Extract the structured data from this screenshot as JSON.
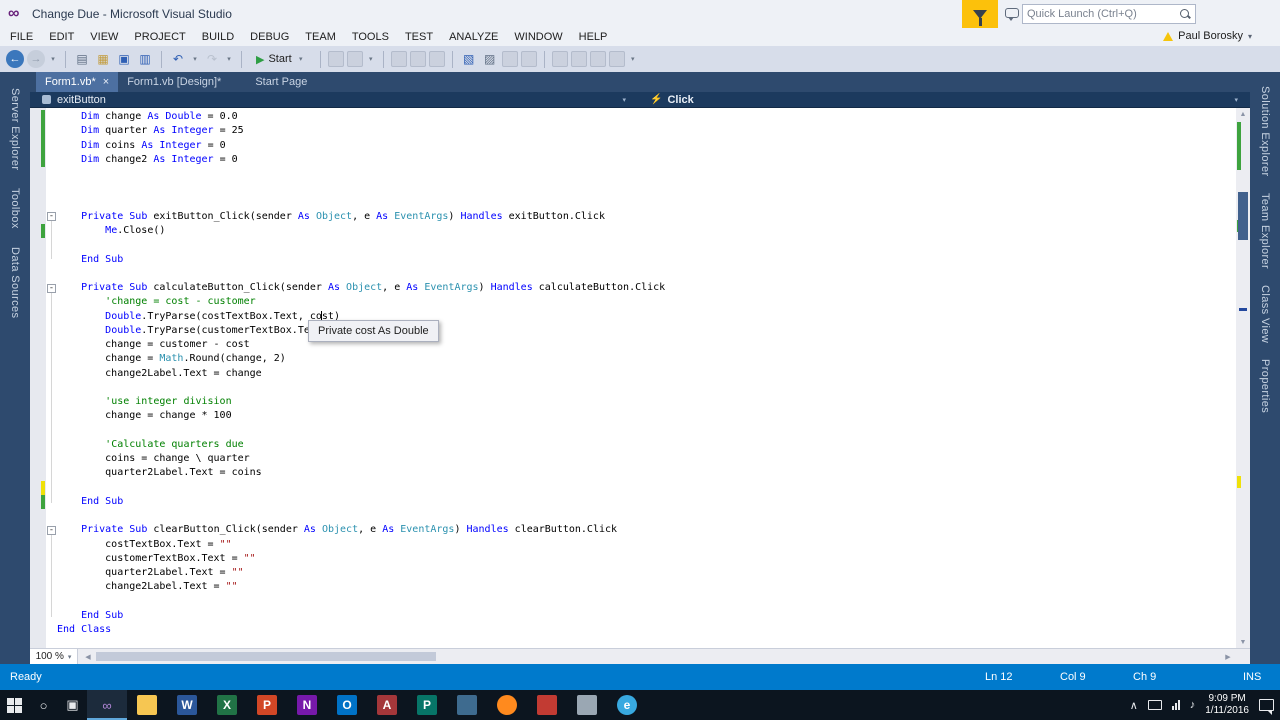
{
  "colors": {
    "status_bar": "#007ACC",
    "shell_dark": "#2E4A6E",
    "active_tab": "#4D70A1",
    "keyword": "#0000FF",
    "type": "#2B91AF",
    "comment": "#008000",
    "string": "#A31515",
    "change_saved_green": "#3EA33E",
    "change_unsaved_yellow": "#EFE109",
    "flask_yellow": "#FCC10B"
  },
  "icons": {
    "vs_logo": "∞",
    "tab_close": "×",
    "dropdown_caret": "▾",
    "event_lightning": "⚡",
    "collapse_minus": "-",
    "scroll_up": "▲",
    "scroll_down": "▼",
    "scroll_left": "◀",
    "scroll_right": "▶",
    "tray_expand": "∧",
    "volume": "♪"
  },
  "titlebar": {
    "title": "Change Due - Microsoft Visual Studio",
    "quick_launch_placeholder": "Quick Launch (Ctrl+Q)"
  },
  "menubar": {
    "items": [
      "FILE",
      "EDIT",
      "VIEW",
      "PROJECT",
      "BUILD",
      "DEBUG",
      "TEAM",
      "TOOLS",
      "TEST",
      "ANALYZE",
      "WINDOW",
      "HELP"
    ],
    "user_name": "Paul Borosky"
  },
  "toolbar": {
    "items": [
      {
        "cls": "circ-blue",
        "name": "nav-back-icon",
        "glyph": "←"
      },
      {
        "cls": "circ-gray",
        "name": "nav-forward-icon",
        "glyph": "→"
      },
      {
        "cls": "caret",
        "name": "nav-history-dropdown-icon",
        "glyph": "▾"
      },
      {
        "cls": "sep",
        "name": "toolbar-separator-1"
      },
      {
        "cls": "ic",
        "name": "new-file-icon",
        "glyph": "▤",
        "color": "#5F6E83"
      },
      {
        "cls": "ic",
        "name": "open-file-icon",
        "glyph": "▦",
        "color": "#C29B3A"
      },
      {
        "cls": "ic",
        "name": "save-icon",
        "glyph": "▣",
        "color": "#2F5FB4"
      },
      {
        "cls": "ic",
        "name": "save-all-icon",
        "glyph": "▥",
        "color": "#2F5FB4"
      },
      {
        "cls": "sep",
        "name": "toolbar-separator-2"
      },
      {
        "cls": "ic",
        "name": "undo-icon",
        "glyph": "↶",
        "color": "#2F5FB4"
      },
      {
        "cls": "caret",
        "name": "undo-dropdown-icon",
        "glyph": "▾"
      },
      {
        "cls": "ic",
        "name": "redo-icon",
        "glyph": "↷",
        "color": "#B9C1CE"
      },
      {
        "cls": "caret",
        "name": "redo-dropdown-icon",
        "glyph": "▾"
      },
      {
        "cls": "sep",
        "name": "toolbar-separator-3"
      },
      {
        "cls": "start",
        "name": "start-debug-button",
        "glyph": "▶",
        "label": "Start"
      },
      {
        "cls": "sep",
        "name": "toolbar-separator-4"
      },
      {
        "cls": "ghost",
        "name": "solution-configurations-dropdown"
      },
      {
        "cls": "ghost",
        "name": "solution-platforms-dropdown"
      },
      {
        "cls": "caret",
        "name": "run-options-dropdown-icon",
        "glyph": "▾"
      },
      {
        "cls": "sep",
        "name": "toolbar-separator-5"
      },
      {
        "cls": "ghost",
        "name": "step-over-icon"
      },
      {
        "cls": "ghost",
        "name": "step-into-icon"
      },
      {
        "cls": "ghost",
        "name": "step-out-icon"
      },
      {
        "cls": "sep",
        "name": "toolbar-separator-6"
      },
      {
        "cls": "ic",
        "name": "find-in-files-icon",
        "glyph": "▧",
        "color": "#2F5FB4"
      },
      {
        "cls": "ic",
        "name": "comment-icon",
        "glyph": "▨",
        "color": "#5F6E83"
      },
      {
        "cls": "ghost",
        "name": "uncomment-icon"
      },
      {
        "cls": "ghost",
        "name": "bookmark-icon"
      },
      {
        "cls": "sep",
        "name": "toolbar-separator-7"
      },
      {
        "cls": "ghost",
        "name": "indent-icon"
      },
      {
        "cls": "ghost",
        "name": "outdent-icon"
      },
      {
        "cls": "ghost",
        "name": "toolbar-icon-extra-1"
      },
      {
        "cls": "ghost",
        "name": "toolbar-icon-extra-2"
      },
      {
        "cls": "caret",
        "name": "toolbar-overflow-icon",
        "glyph": "▾"
      }
    ]
  },
  "document_tabs": [
    {
      "label": "Form1.vb*",
      "active": true
    },
    {
      "label": "Form1.vb [Design]*",
      "active": false
    },
    {
      "label": "Start Page",
      "active": false
    }
  ],
  "tool_tabs_left": [
    "Server Explorer",
    "Toolbox",
    "Data Sources"
  ],
  "tool_tabs_right": [
    "Solution Explorer",
    "Team Explorer",
    "Class View",
    "Properties"
  ],
  "navigation_bar": {
    "scope": "exitButton",
    "member": "Click"
  },
  "editor": {
    "zoom": "100 %",
    "tooltip": "Private cost As Double",
    "code_lines": [
      [
        [
          "pl",
          "    "
        ],
        [
          "kw",
          "Dim"
        ],
        [
          "pl",
          " change "
        ],
        [
          "kw",
          "As"
        ],
        [
          "pl",
          " "
        ],
        [
          "kw",
          "Double"
        ],
        [
          "pl",
          " = 0.0"
        ]
      ],
      [
        [
          "pl",
          "    "
        ],
        [
          "kw",
          "Dim"
        ],
        [
          "pl",
          " quarter "
        ],
        [
          "kw",
          "As"
        ],
        [
          "pl",
          " "
        ],
        [
          "kw",
          "Integer"
        ],
        [
          "pl",
          " = 25"
        ]
      ],
      [
        [
          "pl",
          "    "
        ],
        [
          "kw",
          "Dim"
        ],
        [
          "pl",
          " coins "
        ],
        [
          "kw",
          "As"
        ],
        [
          "pl",
          " "
        ],
        [
          "kw",
          "Integer"
        ],
        [
          "pl",
          " = 0"
        ]
      ],
      [
        [
          "pl",
          "    "
        ],
        [
          "kw",
          "Dim"
        ],
        [
          "pl",
          " change2 "
        ],
        [
          "kw",
          "As"
        ],
        [
          "pl",
          " "
        ],
        [
          "kw",
          "Integer"
        ],
        [
          "pl",
          " = 0"
        ]
      ],
      [],
      [],
      [],
      [
        [
          "pl",
          "    "
        ],
        [
          "kw",
          "Private"
        ],
        [
          "pl",
          " "
        ],
        [
          "kw",
          "Sub"
        ],
        [
          "pl",
          " exitButton_Click(sender "
        ],
        [
          "kw",
          "As"
        ],
        [
          "pl",
          " "
        ],
        [
          "ty",
          "Object"
        ],
        [
          "pl",
          ", e "
        ],
        [
          "kw",
          "As"
        ],
        [
          "pl",
          " "
        ],
        [
          "ty",
          "EventArgs"
        ],
        [
          "pl",
          ") "
        ],
        [
          "kw",
          "Handles"
        ],
        [
          "pl",
          " exitButton.Click"
        ]
      ],
      [
        [
          "pl",
          "        "
        ],
        [
          "kw",
          "Me"
        ],
        [
          "pl",
          ".Close()"
        ]
      ],
      [],
      [
        [
          "pl",
          "    "
        ],
        [
          "kw",
          "End Sub"
        ]
      ],
      [],
      [
        [
          "pl",
          "    "
        ],
        [
          "kw",
          "Private"
        ],
        [
          "pl",
          " "
        ],
        [
          "kw",
          "Sub"
        ],
        [
          "pl",
          " calculateButton_Click(sender "
        ],
        [
          "kw",
          "As"
        ],
        [
          "pl",
          " "
        ],
        [
          "ty",
          "Object"
        ],
        [
          "pl",
          ", e "
        ],
        [
          "kw",
          "As"
        ],
        [
          "pl",
          " "
        ],
        [
          "ty",
          "EventArgs"
        ],
        [
          "pl",
          ") "
        ],
        [
          "kw",
          "Handles"
        ],
        [
          "pl",
          " calculateButton.Click"
        ]
      ],
      [
        [
          "pl",
          "        "
        ],
        [
          "cm",
          "'change = cost - customer"
        ]
      ],
      [
        [
          "pl",
          "        "
        ],
        [
          "kw",
          "Double"
        ],
        [
          "pl",
          ".TryParse(costTextBox.Text, cost)"
        ]
      ],
      [
        [
          "pl",
          "        "
        ],
        [
          "kw",
          "Double"
        ],
        [
          "pl",
          ".TryParse(customerTextBox.Te"
        ]
      ],
      [
        [
          "pl",
          "        change = customer - cost"
        ]
      ],
      [
        [
          "pl",
          "        change = "
        ],
        [
          "ty",
          "Math"
        ],
        [
          "pl",
          ".Round(change, 2)"
        ]
      ],
      [
        [
          "pl",
          "        change2Label.Text = change"
        ]
      ],
      [],
      [
        [
          "pl",
          "        "
        ],
        [
          "cm",
          "'use integer division"
        ]
      ],
      [
        [
          "pl",
          "        change = change * 100"
        ]
      ],
      [],
      [
        [
          "pl",
          "        "
        ],
        [
          "cm",
          "'Calculate quarters due"
        ]
      ],
      [
        [
          "pl",
          "        coins = change \\ quarter"
        ]
      ],
      [
        [
          "pl",
          "        quarter2Label.Text = coins"
        ]
      ],
      [],
      [
        [
          "pl",
          "    "
        ],
        [
          "kw",
          "End Sub"
        ]
      ],
      [],
      [
        [
          "pl",
          "    "
        ],
        [
          "kw",
          "Private"
        ],
        [
          "pl",
          " "
        ],
        [
          "kw",
          "Sub"
        ],
        [
          "pl",
          " clearButton_Click(sender "
        ],
        [
          "kw",
          "As"
        ],
        [
          "pl",
          " "
        ],
        [
          "ty",
          "Object"
        ],
        [
          "pl",
          ", e "
        ],
        [
          "kw",
          "As"
        ],
        [
          "pl",
          " "
        ],
        [
          "ty",
          "EventArgs"
        ],
        [
          "pl",
          ") "
        ],
        [
          "kw",
          "Handles"
        ],
        [
          "pl",
          " clearButton.Click"
        ]
      ],
      [
        [
          "pl",
          "        costTextBox.Text = "
        ],
        [
          "st",
          "\"\""
        ]
      ],
      [
        [
          "pl",
          "        customerTextBox.Text = "
        ],
        [
          "st",
          "\"\""
        ]
      ],
      [
        [
          "pl",
          "        quarter2Label.Text = "
        ],
        [
          "st",
          "\"\""
        ]
      ],
      [
        [
          "pl",
          "        change2Label.Text = "
        ],
        [
          "st",
          "\"\""
        ]
      ],
      [],
      [
        [
          "pl",
          "    "
        ],
        [
          "kw",
          "End Sub"
        ]
      ],
      [
        [
          "kw",
          "End Class"
        ]
      ]
    ]
  },
  "status_bar": {
    "state": "Ready",
    "line": "Ln 12",
    "column": "Col 9",
    "character": "Ch 9",
    "mode": "INS"
  },
  "taskbar": {
    "items": [
      {
        "name": "start-button",
        "kind": "start",
        "sys": true
      },
      {
        "name": "search-icon",
        "kind": "glyph",
        "glyph": "○",
        "sys": true
      },
      {
        "name": "task-view-icon",
        "kind": "glyph",
        "glyph": "▣",
        "sys": true
      },
      {
        "name": "visual-studio-icon",
        "kind": "glyph",
        "glyph": "∞",
        "fg": "#B388D9",
        "active": true
      },
      {
        "name": "file-explorer-icon",
        "kind": "tile",
        "glyph": "",
        "bg": "#F6C652"
      },
      {
        "name": "word-icon",
        "kind": "tile",
        "glyph": "W",
        "fg": "#FFFFFF",
        "bg": "#2B579A"
      },
      {
        "name": "excel-icon",
        "kind": "tile",
        "glyph": "X",
        "fg": "#FFFFFF",
        "bg": "#217346"
      },
      {
        "name": "powerpoint-icon",
        "kind": "tile",
        "glyph": "P",
        "fg": "#FFFFFF",
        "bg": "#D24726"
      },
      {
        "name": "onenote-icon",
        "kind": "tile",
        "glyph": "N",
        "fg": "#FFFFFF",
        "bg": "#7719AA"
      },
      {
        "name": "outlook-icon",
        "kind": "tile",
        "glyph": "O",
        "fg": "#FFFFFF",
        "bg": "#0072C6"
      },
      {
        "name": "access-icon",
        "kind": "tile",
        "glyph": "A",
        "fg": "#FFFFFF",
        "bg": "#A4373A"
      },
      {
        "name": "publisher-icon",
        "kind": "tile",
        "glyph": "P",
        "fg": "#FFFFFF",
        "bg": "#077568"
      },
      {
        "name": "snipping-tool-icon",
        "kind": "tile",
        "glyph": "",
        "bg": "#3E6B8F"
      },
      {
        "name": "firefox-icon",
        "kind": "ball",
        "glyph": "",
        "bg": "#FF8A1E"
      },
      {
        "name": "red-app-icon",
        "kind": "tile",
        "glyph": "",
        "bg": "#C23B33"
      },
      {
        "name": "gray-app-icon",
        "kind": "tile",
        "glyph": "",
        "bg": "#9AA7B3"
      },
      {
        "name": "edge-browser-icon",
        "kind": "ball",
        "glyph": "e",
        "fg": "#FFFFFF",
        "bg": "#38A9E0"
      }
    ]
  },
  "tray": {
    "time": "9:09 PM",
    "date": "1/11/2016"
  }
}
